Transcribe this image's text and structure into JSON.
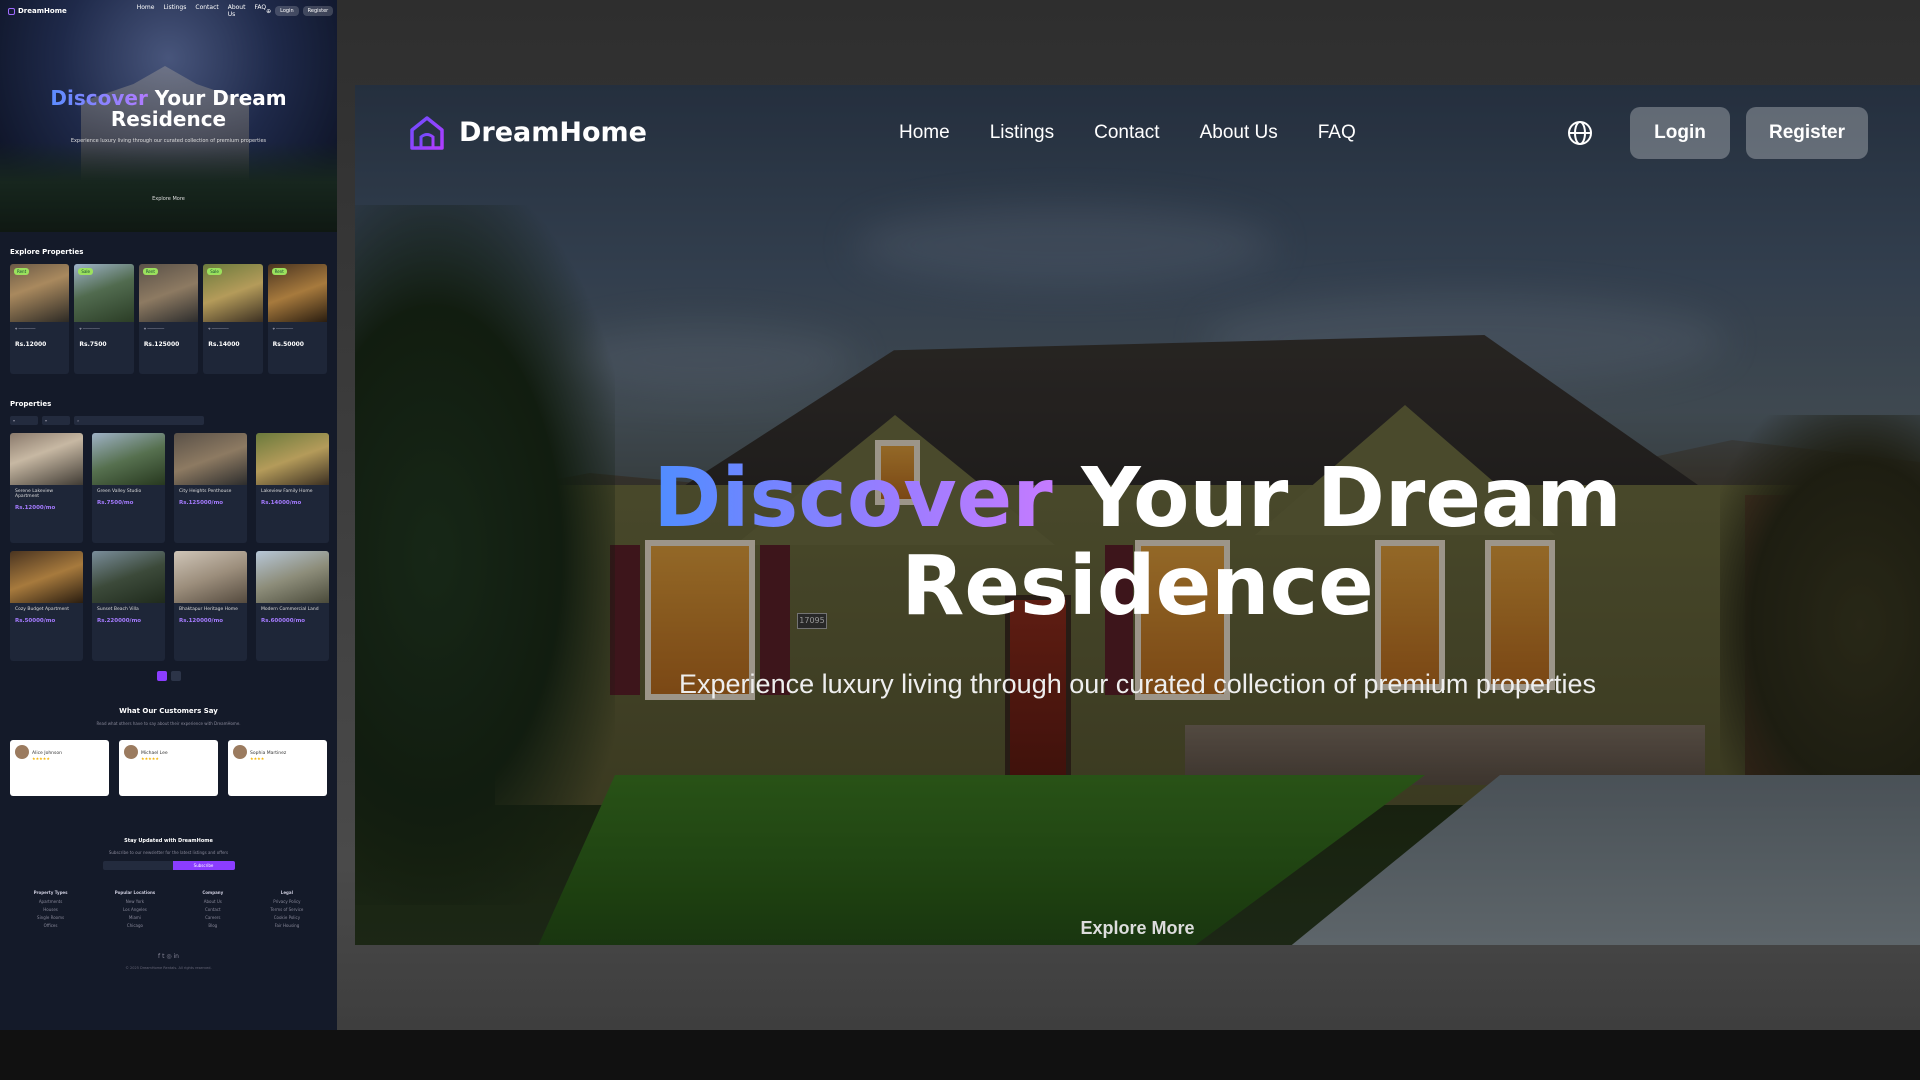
{
  "mini": {
    "brand": "DreamHome",
    "nav": [
      "Home",
      "Listings",
      "Contact",
      "About Us",
      "FAQ"
    ],
    "login": "Login",
    "register": "Register",
    "hero_title_accent": "Discover",
    "hero_title_rest": "Your Dream",
    "hero_title_line2": "Residence",
    "hero_sub": "Experience luxury living through our curated collection of premium properties",
    "explore": "Explore More",
    "explore_heading": "Explore Properties",
    "explore_cards": [
      {
        "tag": "Rent",
        "price": "Rs.12000"
      },
      {
        "tag": "Sale",
        "price": "Rs.7500"
      },
      {
        "tag": "Rent",
        "price": "Rs.125000"
      },
      {
        "tag": "Sale",
        "price": "Rs.14000"
      },
      {
        "tag": "Rent",
        "price": "Rs.50000"
      }
    ],
    "properties_heading": "Properties",
    "properties": [
      {
        "title": "Serene Lakeview Apartment",
        "price": "Rs.12000/mo"
      },
      {
        "title": "Green Valley Studio",
        "price": "Rs.7500/mo"
      },
      {
        "title": "City Heights Penthouse",
        "price": "Rs.125000/mo"
      },
      {
        "title": "Lakeview Family Home",
        "price": "Rs.14000/mo"
      },
      {
        "title": "Cozy Budget Apartment",
        "price": "Rs.50000/mo"
      },
      {
        "title": "Sunset Beach Villa",
        "price": "Rs.220000/mo"
      },
      {
        "title": "Bhaktapur Heritage Home",
        "price": "Rs.120000/mo"
      },
      {
        "title": "Modern Commercial Land",
        "price": "Rs.600000/mo"
      }
    ],
    "testimonials_heading": "What Our Customers Say",
    "testimonials_sub": "Read what others have to say about their experience with DreamHome.",
    "testimonials": [
      {
        "name": "Alice Johnson",
        "stars": "★★★★★"
      },
      {
        "name": "Michael Lee",
        "stars": "★★★★★"
      },
      {
        "name": "Sophia Martinez",
        "stars": "★★★★"
      }
    ],
    "newsletter_heading": "Stay Updated with DreamHome",
    "newsletter_sub": "Subscribe to our newsletter for the latest listings and offers",
    "subscribe": "Subscribe",
    "footer_cols": [
      {
        "title": "Property Types",
        "items": [
          "Apartments",
          "Houses",
          "Single Rooms",
          "Offices"
        ]
      },
      {
        "title": "Popular Locations",
        "items": [
          "New York",
          "Los Angeles",
          "Miami",
          "Chicago"
        ]
      },
      {
        "title": "Company",
        "items": [
          "About Us",
          "Contact",
          "Careers",
          "Blog"
        ]
      },
      {
        "title": "Legal",
        "items": [
          "Privacy Policy",
          "Terms of Service",
          "Cookie Policy",
          "Fair Housing"
        ]
      }
    ],
    "social": "f  t  ◎  in",
    "copyright": "© 2025 DreamHome Rentals. All rights reserved."
  },
  "nav": {
    "brand": "DreamHome",
    "links": [
      "Home",
      "Listings",
      "Contact",
      "About Us",
      "FAQ"
    ],
    "login": "Login",
    "register": "Register"
  },
  "hero": {
    "title_accent": "Discover",
    "title_rest": "Your Dream",
    "title_line2": "Residence",
    "subtitle": "Experience luxury living through our curated collection of premium properties",
    "explore": "Explore More",
    "house_number": "17095"
  },
  "colors": {
    "accent_start": "#4f8dff",
    "accent_end": "#c57bff",
    "logo": "#8b3dff",
    "page_bg": "#141a29"
  }
}
